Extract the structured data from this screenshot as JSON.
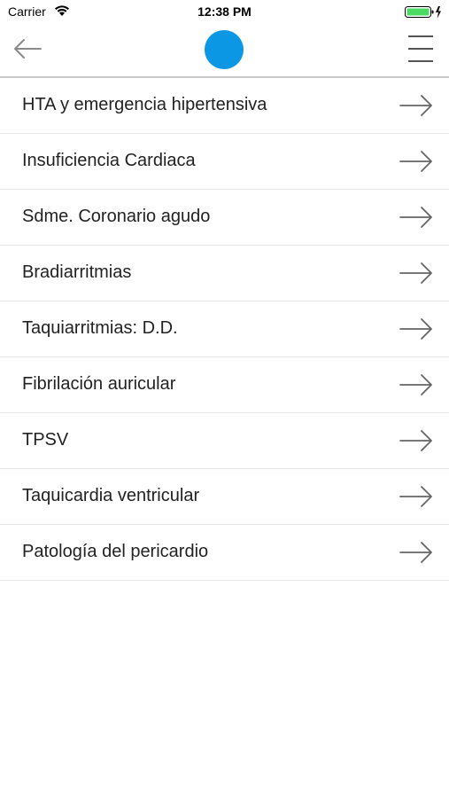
{
  "status_bar": {
    "carrier": "Carrier",
    "time": "12:38 PM",
    "wifi_icon": "wifi-icon",
    "battery_icon": "battery-charging-icon",
    "battery_color": "#4cd964"
  },
  "nav": {
    "back_icon": "arrow-left-icon",
    "logo_color": "#0b97e3",
    "menu_icon": "hamburger-menu-icon"
  },
  "items": [
    {
      "label": "HTA y emergencia hipertensiva"
    },
    {
      "label": "Insuficiencia Cardiaca"
    },
    {
      "label": "Sdme. Coronario agudo"
    },
    {
      "label": "Bradiarritmias"
    },
    {
      "label": "Taquiarritmias: D.D."
    },
    {
      "label": "Fibrilación auricular"
    },
    {
      "label": "TPSV"
    },
    {
      "label": "Taquicardia ventricular"
    },
    {
      "label": "Patología del pericardio"
    }
  ]
}
